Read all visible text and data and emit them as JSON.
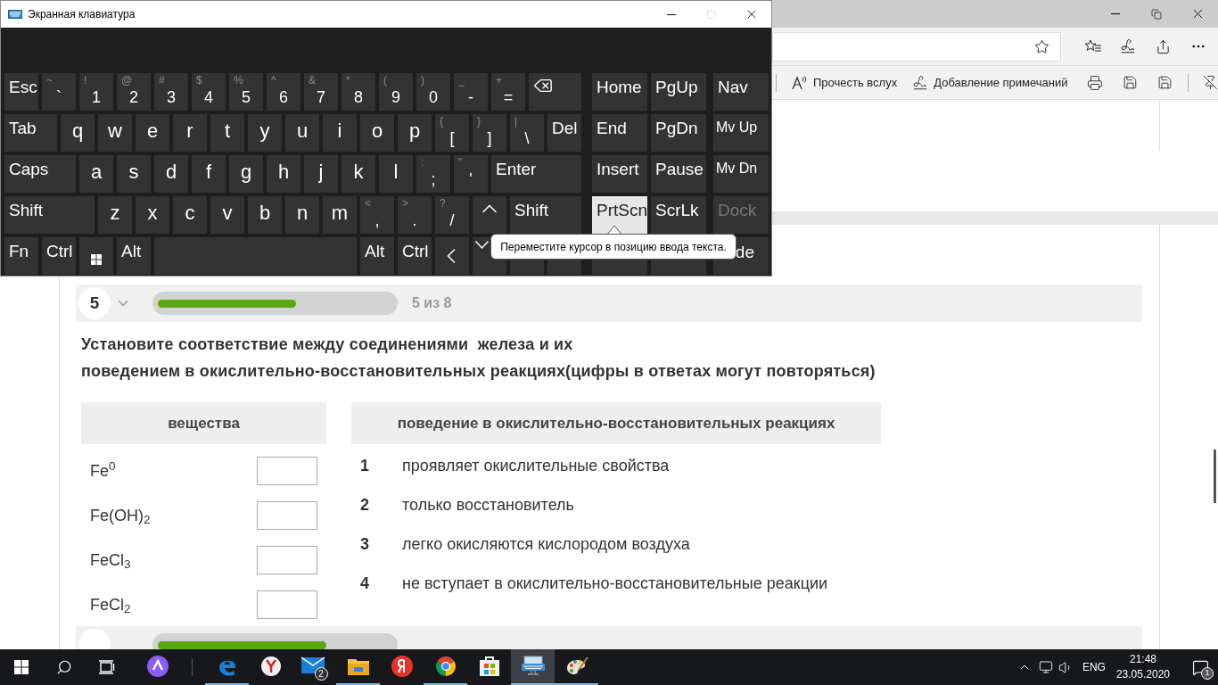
{
  "keyboard_window": {
    "title": "Экранная клавиатура",
    "maximize_disabled": true
  },
  "keys": [
    [
      {
        "kind": "func",
        "label": "Esc"
      },
      {
        "kind": "char",
        "label": "`",
        "shift": "~"
      },
      {
        "kind": "char",
        "label": "1",
        "shift": "!"
      },
      {
        "kind": "char",
        "label": "2",
        "shift": "@"
      },
      {
        "kind": "char",
        "label": "3",
        "shift": "#"
      },
      {
        "kind": "char",
        "label": "4",
        "shift": "$"
      },
      {
        "kind": "char",
        "label": "5",
        "shift": "%"
      },
      {
        "kind": "char",
        "label": "6",
        "shift": "^"
      },
      {
        "kind": "char",
        "label": "7",
        "shift": "&"
      },
      {
        "kind": "char",
        "label": "8",
        "shift": "*"
      },
      {
        "kind": "char",
        "label": "9",
        "shift": "("
      },
      {
        "kind": "char",
        "label": "0",
        "shift": ")"
      },
      {
        "kind": "char",
        "label": "-",
        "shift": "_"
      },
      {
        "kind": "char",
        "label": "=",
        "shift": "+"
      },
      {
        "kind": "backspace"
      }
    ],
    [
      {
        "kind": "func",
        "label": "Tab"
      },
      {
        "kind": "letter",
        "label": "q"
      },
      {
        "kind": "letter",
        "label": "w"
      },
      {
        "kind": "letter",
        "label": "e"
      },
      {
        "kind": "letter",
        "label": "r"
      },
      {
        "kind": "letter",
        "label": "t"
      },
      {
        "kind": "letter",
        "label": "y"
      },
      {
        "kind": "letter",
        "label": "u"
      },
      {
        "kind": "letter",
        "label": "i"
      },
      {
        "kind": "letter",
        "label": "o"
      },
      {
        "kind": "letter",
        "label": "p"
      },
      {
        "kind": "char",
        "label": "[",
        "shift": "{"
      },
      {
        "kind": "char",
        "label": "]",
        "shift": "}"
      },
      {
        "kind": "char",
        "label": "\\",
        "shift": "|"
      },
      {
        "kind": "func",
        "label": "Del"
      }
    ],
    [
      {
        "kind": "func",
        "label": "Caps"
      },
      {
        "kind": "letter",
        "label": "a"
      },
      {
        "kind": "letter",
        "label": "s"
      },
      {
        "kind": "letter",
        "label": "d"
      },
      {
        "kind": "letter",
        "label": "f"
      },
      {
        "kind": "letter",
        "label": "g"
      },
      {
        "kind": "letter",
        "label": "h"
      },
      {
        "kind": "letter",
        "label": "j"
      },
      {
        "kind": "letter",
        "label": "k"
      },
      {
        "kind": "letter",
        "label": "l"
      },
      {
        "kind": "char",
        "label": ";",
        "shift": ":"
      },
      {
        "kind": "char",
        "label": "'",
        "shift": "\""
      },
      {
        "kind": "func",
        "label": "Enter"
      }
    ],
    [
      {
        "kind": "func",
        "label": "Shift"
      },
      {
        "kind": "letter",
        "label": "z"
      },
      {
        "kind": "letter",
        "label": "x"
      },
      {
        "kind": "letter",
        "label": "c"
      },
      {
        "kind": "letter",
        "label": "v"
      },
      {
        "kind": "letter",
        "label": "b"
      },
      {
        "kind": "letter",
        "label": "n"
      },
      {
        "kind": "letter",
        "label": "m"
      },
      {
        "kind": "char",
        "label": ",",
        "shift": "<"
      },
      {
        "kind": "char",
        "label": ".",
        "shift": ">"
      },
      {
        "kind": "char",
        "label": "/",
        "shift": "?"
      },
      {
        "kind": "arrow-up"
      },
      {
        "kind": "func",
        "label": "Shift"
      }
    ],
    [
      {
        "kind": "func",
        "label": "Fn"
      },
      {
        "kind": "func",
        "label": "Ctrl"
      },
      {
        "kind": "windows"
      },
      {
        "kind": "func",
        "label": "Alt"
      },
      {
        "kind": "blank"
      },
      {
        "kind": "func",
        "label": "Alt"
      },
      {
        "kind": "func",
        "label": "Ctrl"
      },
      {
        "kind": "arrow-left"
      },
      {
        "kind": "arrow-down"
      },
      {
        "kind": "blank"
      },
      {
        "kind": "blank"
      }
    ]
  ],
  "nav_keys": [
    [
      {
        "kind": "func",
        "label": "Home",
        "hovered": false,
        "disabled": false
      },
      {
        "kind": "func",
        "label": "PgUp",
        "hovered": false,
        "disabled": false
      },
      {
        "kind": "func",
        "label": "Nav",
        "hovered": false,
        "disabled": false
      }
    ],
    [
      {
        "kind": "func",
        "label": "End",
        "hovered": false,
        "disabled": false
      },
      {
        "kind": "func",
        "label": "PgDn",
        "hovered": false,
        "disabled": false
      },
      {
        "kind": "small",
        "label": "Mv Up",
        "hovered": false,
        "disabled": false
      }
    ],
    [
      {
        "kind": "func",
        "label": "Insert",
        "hovered": false,
        "disabled": false
      },
      {
        "kind": "func",
        "label": "Pause",
        "hovered": false,
        "disabled": false
      },
      {
        "kind": "small",
        "label": "Mv Dn",
        "hovered": false,
        "disabled": false
      }
    ],
    [
      {
        "kind": "func",
        "label": "PrtScn",
        "hovered": true,
        "disabled": false
      },
      {
        "kind": "func",
        "label": "ScrLk",
        "hovered": false,
        "disabled": false
      },
      {
        "kind": "func",
        "label": "Dock",
        "hovered": false,
        "disabled": true
      }
    ],
    [
      {
        "kind": "blank"
      },
      {
        "kind": "blank"
      },
      {
        "kind": "partly-covered",
        "label": "de",
        "hovered": false,
        "disabled": false
      }
    ]
  ],
  "tooltip": "Переместите курсор в позицию ввода текста.",
  "browser": {
    "toolbar": [
      {
        "kind": "read-aloud",
        "label": "Прочесть вслух"
      },
      {
        "kind": "annotate",
        "label": "Добавление примечаний"
      }
    ]
  },
  "question": {
    "number": "5",
    "level": 0.59,
    "progress_text": "5 из 8",
    "lines": [
      "Установите соответствие между соединениями  железа и их",
      "поведением в окислительно-восстановительных реакциях(цифры в ответах могут повторяться)"
    ],
    "left_header": "вещества",
    "right_header": "поведение в окислительно-восстановительных реакциях",
    "substances": [
      {
        "formula": "Fe$^{0}$"
      },
      {
        "formula": "Fe(OH)$_{2}$"
      },
      {
        "formula": "FeCl$_{3}$"
      },
      {
        "formula": "FeCl$_{2}$"
      }
    ],
    "behaviors": [
      {
        "number": "1",
        "text": "проявляет окислительные свойства"
      },
      {
        "number": "2",
        "text": "только восстановитель"
      },
      {
        "number": "3",
        "text": "легко окисляются кислородом воздуха"
      },
      {
        "number": "4",
        "text": "не вступает в окислительно-восстановительные реакции"
      }
    ]
  },
  "next_question": {
    "level": 0.72
  },
  "taskbar": {
    "apps": [
      {
        "kind": "alice",
        "running": false,
        "active": false
      },
      {
        "kind": "edge",
        "running": true,
        "active": false
      },
      {
        "kind": "yandex-browser",
        "running": false,
        "active": false
      },
      {
        "kind": "mail",
        "badge": "2",
        "running": false,
        "active": false
      },
      {
        "kind": "explorer",
        "running": true,
        "active": false
      },
      {
        "kind": "yandex",
        "running": false,
        "active": false
      },
      {
        "kind": "chrome",
        "running": true,
        "active": false
      },
      {
        "kind": "store",
        "running": false,
        "active": false
      },
      {
        "kind": "keyboard",
        "running": true,
        "active": true
      },
      {
        "kind": "paint",
        "running": true,
        "active": false
      }
    ],
    "language": "ENG",
    "time": "21:48",
    "date": "23.05.2020",
    "notifications": "1"
  }
}
